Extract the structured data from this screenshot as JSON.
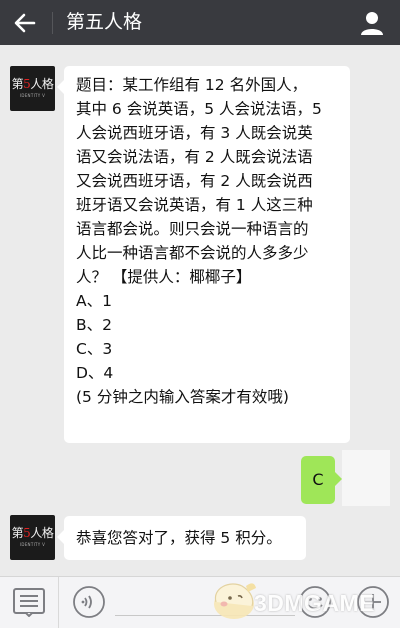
{
  "header": {
    "title": "第五人格",
    "back_icon": "back-arrow-icon",
    "user_icon": "user-profile-icon"
  },
  "bot": {
    "avatar_logo_parts": [
      "第",
      "5",
      "人格"
    ],
    "avatar_logo_sub": "IDENTITY V"
  },
  "messages": {
    "question_lines": [
      "题目：某工作组有 12 名外国人，",
      "其中 6 会说英语，5 人会说法语，5",
      "人会说西班牙语，有 3 人既会说英",
      "语又会说法语，有 2 人既会说法语",
      "又会说西班牙语，有 2 人既会说西",
      "班牙语又会说英语，有 1 人这三种",
      "语言都会说。则只会说一种语言的",
      "人比一种语言都不会说的人多多少",
      "人？ 【提供人：椰椰子】",
      "A、1",
      "B、2",
      "C、3",
      "D、4",
      "(5 分钟之内输入答案才有效哦)"
    ],
    "user_reply": "C",
    "bot_reply": "恭喜您答对了，获得 5 积分。"
  },
  "toolbar": {
    "menu_icon": "menu-list-icon",
    "voice_icon": "voice-icon",
    "emoji_icon": "emoji-icon",
    "plus_icon": "plus-icon"
  },
  "watermark": {
    "text": "3DMGAME"
  },
  "colors": {
    "header_bg": "#393a3f",
    "chat_bg": "#ebebeb",
    "user_bubble": "#9fe658",
    "bot_bubble": "#ffffff"
  }
}
